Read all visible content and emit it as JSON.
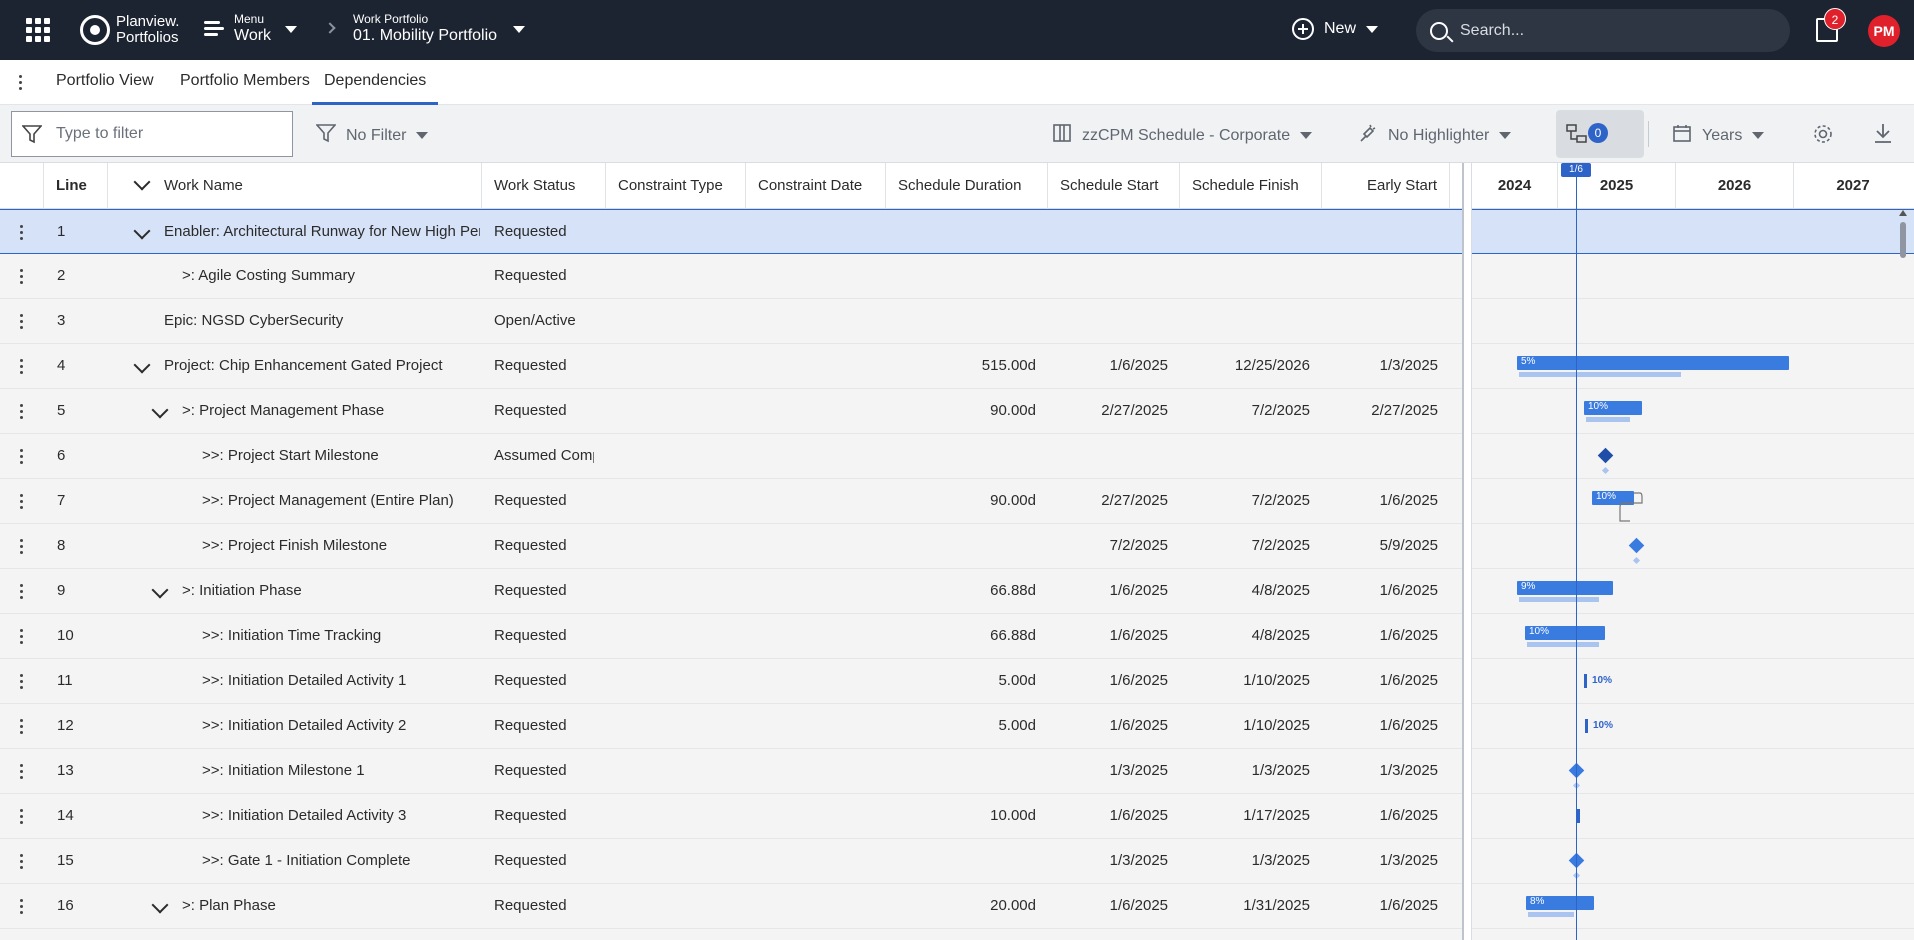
{
  "header": {
    "brand_line1": "Planview.",
    "brand_line2": "Portfolios",
    "menu_small": "Menu",
    "menu_big": "Work",
    "portfolio_small": "Work Portfolio",
    "portfolio_big": "01. Mobility Portfolio",
    "new_label": "New",
    "search_placeholder": "Search...",
    "notification_count": "2",
    "user_initials": "PM"
  },
  "tabs": [
    {
      "label": "Portfolio View",
      "active": false
    },
    {
      "label": "Portfolio Members",
      "active": false
    },
    {
      "label": "Dependencies",
      "active": true
    }
  ],
  "toolbar": {
    "filter_placeholder": "Type to filter",
    "filter_label": "No Filter",
    "schedule_label": "zzCPM Schedule - Corporate",
    "highlighter_label": "No Highlighter",
    "dependency_count": "0",
    "timescale_label": "Years"
  },
  "columns": [
    "Line",
    "Work Name",
    "Work Status",
    "Constraint Type",
    "Constraint Date",
    "Schedule Duration",
    "Schedule Start",
    "Schedule Finish",
    "Early Start"
  ],
  "rows": [
    {
      "line": "1",
      "name": "Enabler: Architectural Runway for New High Performance Chip",
      "status": "Requested",
      "ctype": "",
      "cdate": "",
      "duration": "",
      "start": "",
      "finish": "",
      "early": ""
    },
    {
      "line": "2",
      "name": ">: Agile Costing Summary",
      "status": "Requested",
      "ctype": "",
      "cdate": "",
      "duration": "",
      "start": "",
      "finish": "",
      "early": ""
    },
    {
      "line": "3",
      "name": "Epic: NGSD CyberSecurity",
      "status": "Open/Active",
      "ctype": "",
      "cdate": "",
      "duration": "",
      "start": "",
      "finish": "",
      "early": ""
    },
    {
      "line": "4",
      "name": "Project: Chip Enhancement Gated Project",
      "status": "Requested",
      "ctype": "",
      "cdate": "",
      "duration": "515.00d",
      "start": "1/6/2025",
      "finish": "12/25/2026",
      "early": "1/3/2025"
    },
    {
      "line": "5",
      "name": ">: Project Management Phase",
      "status": "Requested",
      "ctype": "",
      "cdate": "",
      "duration": "90.00d",
      "start": "2/27/2025",
      "finish": "7/2/2025",
      "early": "2/27/2025"
    },
    {
      "line": "6",
      "name": ">>: Project Start Milestone",
      "status": "Assumed Complete",
      "ctype": "",
      "cdate": "",
      "duration": "",
      "start": "",
      "finish": "",
      "early": ""
    },
    {
      "line": "7",
      "name": ">>: Project Management (Entire Plan)",
      "status": "Requested",
      "ctype": "",
      "cdate": "",
      "duration": "90.00d",
      "start": "2/27/2025",
      "finish": "7/2/2025",
      "early": "1/6/2025"
    },
    {
      "line": "8",
      "name": ">>: Project Finish Milestone",
      "status": "Requested",
      "ctype": "",
      "cdate": "",
      "duration": "",
      "start": "7/2/2025",
      "finish": "7/2/2025",
      "early": "5/9/2025"
    },
    {
      "line": "9",
      "name": ">: Initiation Phase",
      "status": "Requested",
      "ctype": "",
      "cdate": "",
      "duration": "66.88d",
      "start": "1/6/2025",
      "finish": "4/8/2025",
      "early": "1/6/2025"
    },
    {
      "line": "10",
      "name": ">>: Initiation Time Tracking",
      "status": "Requested",
      "ctype": "",
      "cdate": "",
      "duration": "66.88d",
      "start": "1/6/2025",
      "finish": "4/8/2025",
      "early": "1/6/2025"
    },
    {
      "line": "11",
      "name": ">>: Initiation Detailed Activity 1",
      "status": "Requested",
      "ctype": "",
      "cdate": "",
      "duration": "5.00d",
      "start": "1/6/2025",
      "finish": "1/10/2025",
      "early": "1/6/2025"
    },
    {
      "line": "12",
      "name": ">>: Initiation Detailed Activity 2",
      "status": "Requested",
      "ctype": "",
      "cdate": "",
      "duration": "5.00d",
      "start": "1/6/2025",
      "finish": "1/10/2025",
      "early": "1/6/2025"
    },
    {
      "line": "13",
      "name": ">>: Initiation Milestone 1",
      "status": "Requested",
      "ctype": "",
      "cdate": "",
      "duration": "",
      "start": "1/3/2025",
      "finish": "1/3/2025",
      "early": "1/3/2025"
    },
    {
      "line": "14",
      "name": ">>: Initiation Detailed Activity 3",
      "status": "Requested",
      "ctype": "",
      "cdate": "",
      "duration": "10.00d",
      "start": "1/6/2025",
      "finish": "1/17/2025",
      "early": "1/6/2025"
    },
    {
      "line": "15",
      "name": ">>: Gate 1 - Initiation Complete",
      "status": "Requested",
      "ctype": "",
      "cdate": "",
      "duration": "",
      "start": "1/3/2025",
      "finish": "1/3/2025",
      "early": "1/3/2025"
    },
    {
      "line": "16",
      "name": ">: Plan Phase",
      "status": "Requested",
      "ctype": "",
      "cdate": "",
      "duration": "20.00d",
      "start": "1/6/2025",
      "finish": "1/31/2025",
      "early": "1/6/2025"
    }
  ],
  "gantt": {
    "years": [
      "2024",
      "2025",
      "2026",
      "2027"
    ],
    "today_label": "1/6",
    "progress": {
      "row4": "5%",
      "row5": "10%",
      "row7": "10%",
      "row9": "9%",
      "row10": "10%",
      "row11": "10%",
      "row12": "10%",
      "row16": "8%"
    }
  },
  "colors": {
    "header_bg": "#1d2431",
    "accent": "#2e63c7",
    "bar": "#3a7be0",
    "baseline": "#a9c4ef",
    "badge": "#e0212b"
  }
}
